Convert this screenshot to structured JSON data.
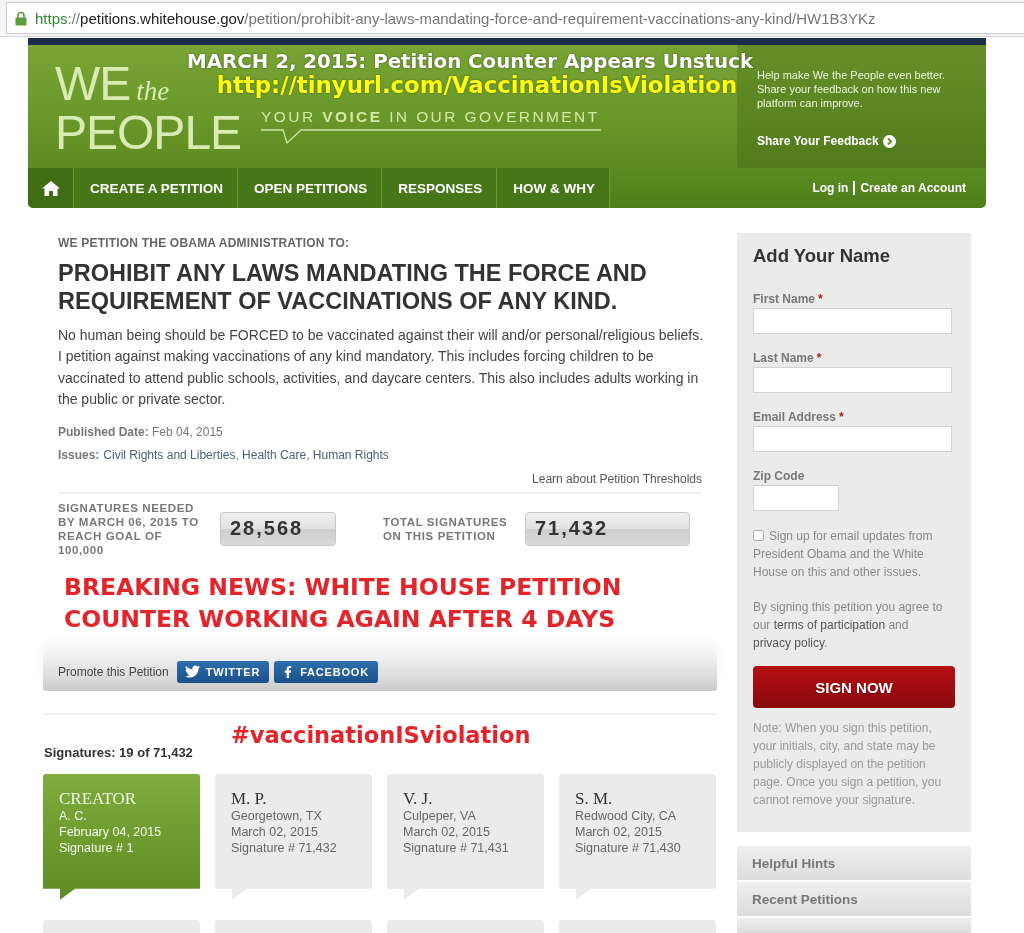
{
  "browser": {
    "url_parts": [
      {
        "text": "https",
        "kind": "scheme"
      },
      {
        "text": "://",
        "kind": "rest"
      },
      {
        "text": "petitions.whitehouse.gov",
        "kind": "host"
      },
      {
        "text": "/petition/prohibit-any-laws-mandating-force-and-requirement-vaccinations-any-kind/HW1B3YKz",
        "kind": "rest"
      }
    ]
  },
  "banner": {
    "logo": {
      "we": "WE",
      "the": "the",
      "people": "PEOPLE"
    },
    "tagline": "YOUR **VOICE** IN OUR GOVERNMENT",
    "announcement": {
      "headline": "MARCH 2, 2015: Petition Counter Appears Unstuck",
      "link": "http://tinyurl.com/VaccinationIsViolation"
    },
    "feedback": {
      "text": "Help make We the People even better. Share your feedback on how this new platform can improve.",
      "link": "Share Your Feedback"
    }
  },
  "nav": {
    "items": [
      {
        "label": "CREATE A PETITION",
        "selected": false
      },
      {
        "label": "OPEN PETITIONS",
        "selected": false
      },
      {
        "label": "RESPONSES",
        "selected": false
      },
      {
        "label": "HOW & WHY",
        "selected": false
      }
    ],
    "account_links": [
      "Log in",
      "Create an Account"
    ]
  },
  "petition": {
    "eyebrow": "WE PETITION THE OBAMA ADMINISTRATION TO:",
    "title": "PROHIBIT ANY LAWS MANDATING THE FORCE AND REQUIREMENT OF VACCINATIONS OF ANY KIND.",
    "body": "No human being should be FORCED to be vaccinated against their will and/or personal/religious beliefs. I petition against making vaccinations of any kind mandatory. This includes forcing children to be vaccinated to attend public schools, activities, and daycare centers. This also includes adults working in the public or private sector.",
    "published": "**Published Date:** Feb 04, 2015",
    "issues": {
      "label": "Issues:",
      "parts": [
        {
          "text": "Civil Rights and Liberties",
          "link": true
        },
        {
          "text": ", ",
          "link": false
        },
        {
          "text": "Health Care",
          "link": true
        },
        {
          "text": ", ",
          "link": false
        },
        {
          "text": "Human Rights",
          "link": true
        }
      ]
    },
    "thresholds_link": "Learn about Petition Thresholds"
  },
  "stats": [
    {
      "label": "SIGNATURES NEEDED BY MARCH 06, 2015 TO REACH GOAL OF 100,000",
      "value": "28,568",
      "kind": "needed"
    },
    {
      "label": "TOTAL SIGNATURES ON THIS PETITION",
      "value": "71,432",
      "kind": "total"
    }
  ],
  "breaking_news": "BREAKING NEWS: WHITE HOUSE PETITION COUNTER WORKING AGAIN AFTER 4 DAYS",
  "promote": {
    "label": "Promote this Petition",
    "buttons": [
      {
        "label": "TWITTER",
        "kind": "twitter"
      },
      {
        "label": "FACEBOOK",
        "kind": "facebook"
      }
    ]
  },
  "hashtag": "#vaccinationISviolation",
  "signatures": {
    "count": "Signatures: 19 of 71,432",
    "cards": [
      {
        "kind": "creator",
        "heading": "CREATOR",
        "lines": [
          "A. C.",
          "February 04, 2015",
          "Signature # 1"
        ]
      },
      {
        "kind": "signer",
        "heading": "M. P.",
        "lines": [
          "Georgetown, TX",
          "March 02, 2015",
          "Signature # 71,432"
        ]
      },
      {
        "kind": "signer",
        "heading": "V. J.",
        "lines": [
          "Culpeper, VA",
          "March 02, 2015",
          "Signature # 71,431"
        ]
      },
      {
        "kind": "signer",
        "heading": "S. M.",
        "lines": [
          "Redwood City, CA",
          "March 02, 2015",
          "Signature # 71,430"
        ]
      },
      {
        "kind": "cut"
      },
      {
        "kind": "cut"
      },
      {
        "kind": "cut"
      },
      {
        "kind": "cut"
      }
    ]
  },
  "sign_form": {
    "title": "Add Your Name",
    "required_mark": "*",
    "fields": [
      {
        "label": "First Name",
        "required": true,
        "kind": "wide"
      },
      {
        "label": "Last Name",
        "required": true,
        "kind": "wide"
      },
      {
        "label": "Email Address",
        "required": true,
        "kind": "wide"
      },
      {
        "label": "Zip Code",
        "required": false,
        "kind": "short"
      }
    ],
    "updates": {
      "label": "Sign up for email updates from President Obama and the White House on this and other issues.",
      "checked": false
    },
    "agreement": [
      {
        "text": "By signing this petition you agree to our ",
        "link": false
      },
      {
        "text": "terms of participation",
        "link": true
      },
      {
        "text": " and ",
        "link": false
      },
      {
        "text": "privacy policy",
        "link": true
      },
      {
        "text": ".",
        "link": false
      }
    ],
    "submit": "SIGN NOW",
    "note": "Note: When you sign this petition, your initials, city, and state may be publicly displayed on the petition page. Once you sign a petition, you cannot remove your signature."
  },
  "side_panels": [
    {
      "kind": "full",
      "label": "Helpful Hints"
    },
    {
      "kind": "full",
      "label": "Recent Petitions"
    },
    {
      "kind": "cut"
    }
  ]
}
